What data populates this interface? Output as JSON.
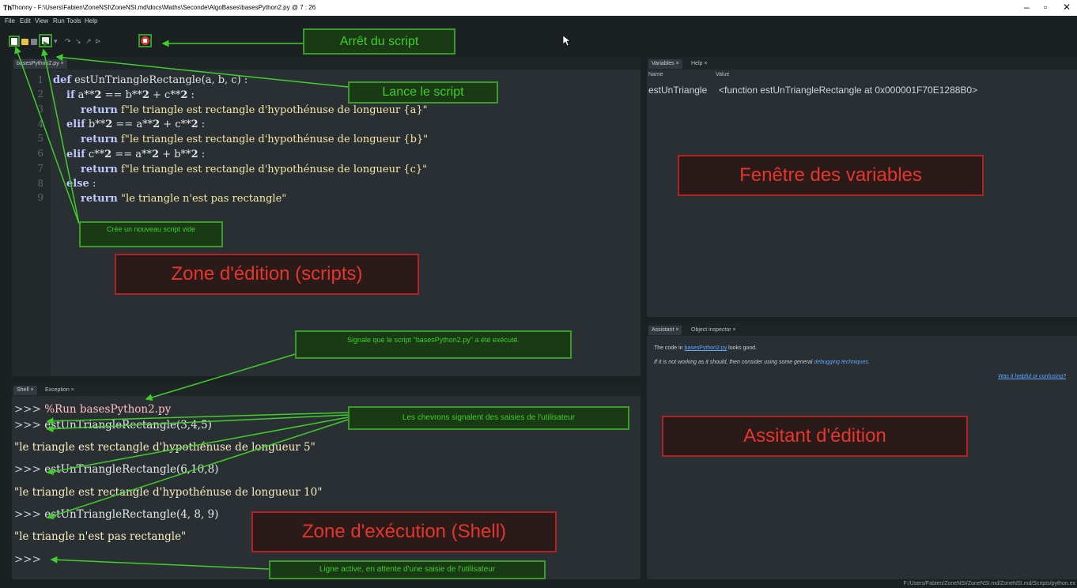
{
  "window": {
    "app_icon": "Th",
    "title": "Thonny  -  F:\\Users\\Fabien\\ZoneNSI\\ZoneNSI.md\\docs\\Maths\\Seconde\\AlgoBases\\basesPython2.py  @  7 : 26",
    "minimize": "–",
    "maximize": "▫",
    "close": "✕"
  },
  "menu": [
    "File",
    "Edit",
    "View",
    "Run",
    "Tools",
    "Help"
  ],
  "editor": {
    "tab": "basesPython2.py ×",
    "line_numbers": [
      "1",
      "2",
      "3",
      "4",
      "5",
      "6",
      "7",
      "8",
      "9"
    ]
  },
  "variables": {
    "tabs": [
      "Variables ×",
      "Help ×"
    ],
    "col_name": "Name",
    "col_value": "Value",
    "row_name": "estUnTriangl̵",
    "row_name_display": "estUnTriangle",
    "row_value": "<function estUnTriangleRectangle at 0x000001F70E1288B0>"
  },
  "assistant": {
    "tabs": [
      "Assistant ×",
      "Object inspector ×"
    ],
    "line1_prefix": "The code in ",
    "line1_link": "basesPython2.py",
    "line1_suffix": " looks good.",
    "line2_prefix": "If it is not working as it should, then consider using some general ",
    "line2_link": "debugging techniques",
    "line2_suffix": ".",
    "feedback_link": "Was it helpful or confusing?"
  },
  "shell": {
    "tabs": [
      "Shell ×",
      "Exception ×"
    ],
    "prompt": ">>>",
    "run_cmd": "%Run basesPython2.py",
    "call1": "estUnTriangleRectangle(3,4,5)",
    "out1": "\"le triangle est rectangle d'hypothénuse de longueur 5\"",
    "call2": "estUnTriangleRectangle(6,10,8)",
    "out2": "\"le triangle est rectangle d'hypothénuse de longueur 10\"",
    "call3": "estUnTriangleRectangle(4, 8, 9)",
    "out3": "\"le triangle n'est pas rectangle\""
  },
  "statusbar": {
    "path": "F:/Users/Fabien/ZoneNSI/ZoneNSI.md/ZoneNSI.md/Scripts/python.ex"
  },
  "annotations": {
    "stop": "Arrêt du script",
    "run": "Lance le script",
    "new_script": "Crée un nouveau script vide",
    "editor_zone": "Zone d'édition (scripts)",
    "executed": "Signale que le script \"basesPython2.py\" a été exécuté.",
    "chevrons": "Les chevrons signalent des saisies de l'utilisateur",
    "shell_zone": "Zone d'exécution (Shell)",
    "active_line": "Ligne active, en attente d'une saisie de l'utilisateur",
    "variables_zone": "Fenêtre des variables",
    "assistant_zone": "Assitant d'édition"
  },
  "colors": {
    "annotation_green": "#3ecf2a",
    "annotation_red": "#e8352a",
    "editor_bg": "#2a2f33",
    "keyword": "#bfc8ff",
    "string": "#f4e8a6"
  }
}
